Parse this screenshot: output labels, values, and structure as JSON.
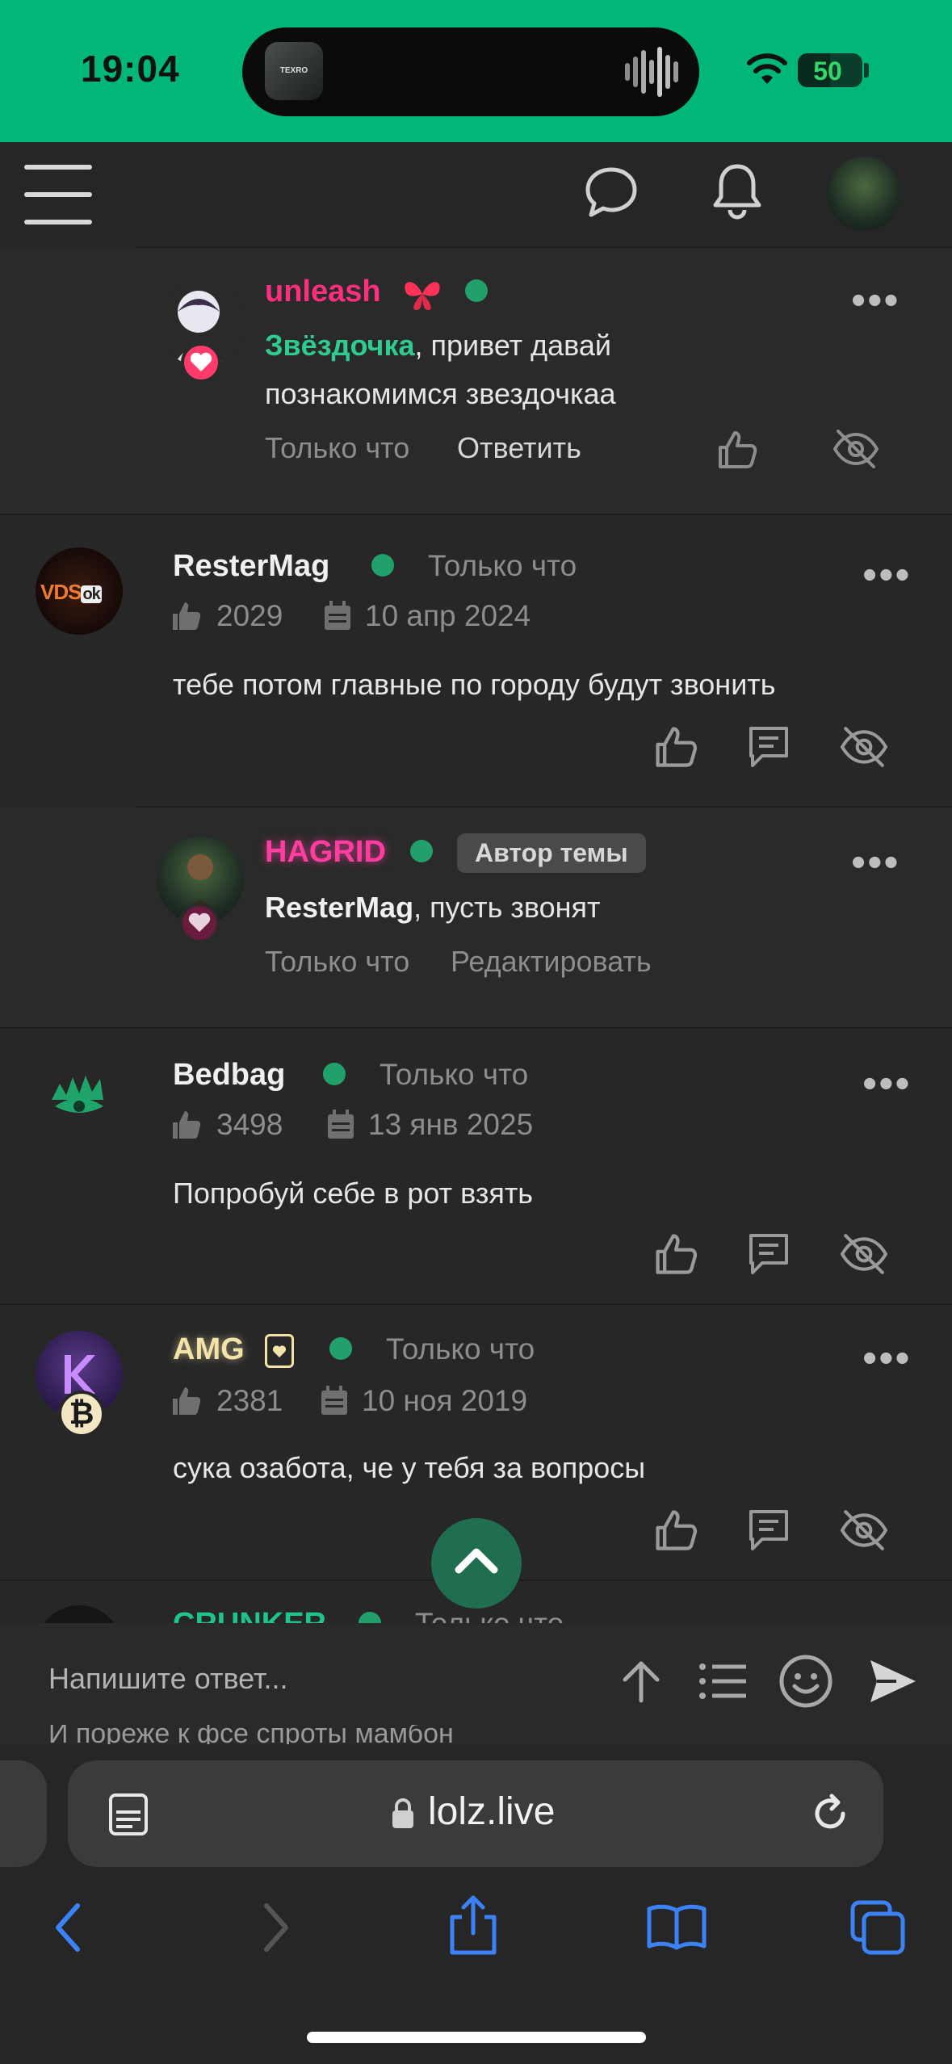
{
  "status_bar": {
    "time": "19:04",
    "island_app_label": "TEXRO",
    "battery": "50",
    "icons": [
      "soundwave-icon",
      "wifi-icon",
      "battery-icon"
    ]
  },
  "header": {
    "icons": [
      "hamburger-menu-icon",
      "chat-bubble-icon",
      "bell-icon",
      "profile-avatar"
    ]
  },
  "comments": [
    {
      "username": "unleash",
      "username_color": "#ff2e7e",
      "mention": "Звёздочка",
      "mention_color": "#2ecc8f",
      "text": ", привет давай",
      "text_line2": "познакомимся звездочкаа",
      "time": "Только что",
      "reply_label": "Ответить"
    },
    {
      "username": "ResterMag",
      "time": "Только что",
      "likes": "2029",
      "reg_date": "10 апр 2024",
      "text": "тебе потом главные по городу будут звонить"
    },
    {
      "username": "HAGRID",
      "username_color": "#ff3da0",
      "badge": "Автор темы",
      "mention": "ResterMag",
      "text": ", пусть звонят",
      "time": "Только что",
      "edit_label": "Редактировать"
    },
    {
      "username": "Bedbag",
      "time": "Только что",
      "likes": "3498",
      "reg_date": "13 янв 2025",
      "text": "Попробуй себе в рот взять"
    },
    {
      "username": "AMG",
      "username_color": "#f4e3a8",
      "time": "Только что",
      "likes": "2381",
      "reg_date": "10 ноя 2019",
      "text": "сука озабота, че у тебя за вопросы"
    },
    {
      "username": "CRUNKER",
      "time": "Только что"
    }
  ],
  "reply_bar": {
    "placeholder": "Напишите ответ...",
    "hidden_text": "И пореже к фсе спроты мамбон"
  },
  "browser": {
    "url": "lolz.live"
  },
  "colors": {
    "status_green": "#00b779",
    "online": "#22a06b",
    "background": "#262626"
  }
}
